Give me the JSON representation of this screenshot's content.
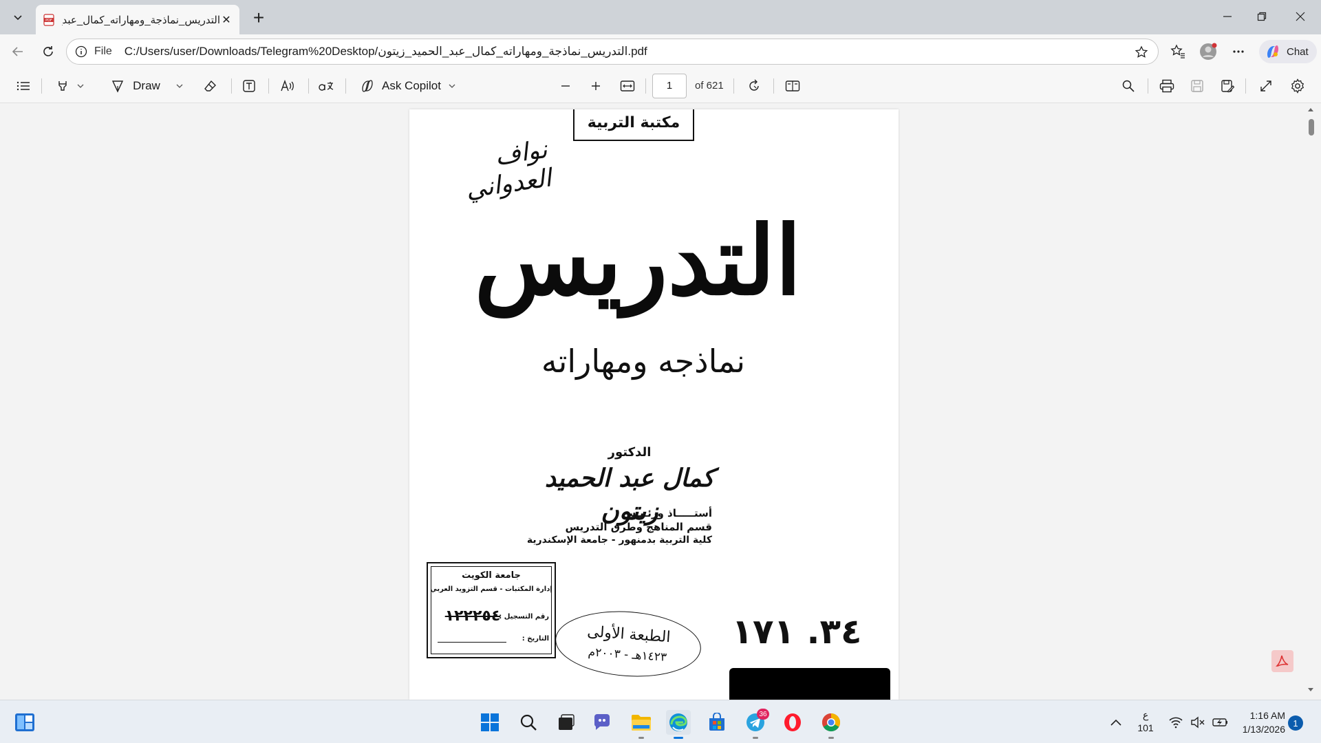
{
  "browser": {
    "tab": {
      "title": "التدريس_نماذجة_ومهاراته_كمال_عبد_",
      "close_glyph": "✕"
    },
    "new_tab_glyph": "+",
    "address": {
      "scheme_label": "File",
      "url": "C:/Users/user/Downloads/Telegram%20Desktop/التدريس_نماذجة_ومهاراته_كمال_عبد_الحميد_زيتون.pdf"
    },
    "chat_label": "Chat"
  },
  "pdf_toolbar": {
    "draw_label": "Draw",
    "copilot_label": "Ask Copilot",
    "page_number": "1",
    "page_count": "of 621"
  },
  "document": {
    "library_stamp": "مكتبة التربية",
    "handwritten_owner": "نواف العدواني",
    "title": "التدريس",
    "subtitle": "نماذجه ومهاراته",
    "author_prefix": "الدكتور",
    "author_name": "كمال عبد الحميد زيتون",
    "author_role_1": "أستـــــاذ ورئـيـس",
    "author_role_2": "قسم المناهج وطرق التدريس",
    "author_role_3": "كلية التربية بدمنهور - جامعة الإسكندرية",
    "university_stamp": {
      "line1": "جامعة الكويت",
      "line2": "إدارة المكتبات - قسم التزويد العربي",
      "reg_label": "رقم التسجيل :",
      "reg_number": "١٢٢٢٥٤",
      "date_label": "التاريخ :"
    },
    "edition_stamp": {
      "line1": "الطبعة الأولى",
      "line2": "١٤٢٣هـ - ٢٠٠٣م"
    },
    "call_number": "٣٤. ١٧١"
  },
  "taskbar": {
    "telegram_badge": "36",
    "lang_line1": "ع",
    "lang_line2": "101",
    "time": "1:16 AM",
    "date": "1/13/2026",
    "notification_count": "1"
  }
}
